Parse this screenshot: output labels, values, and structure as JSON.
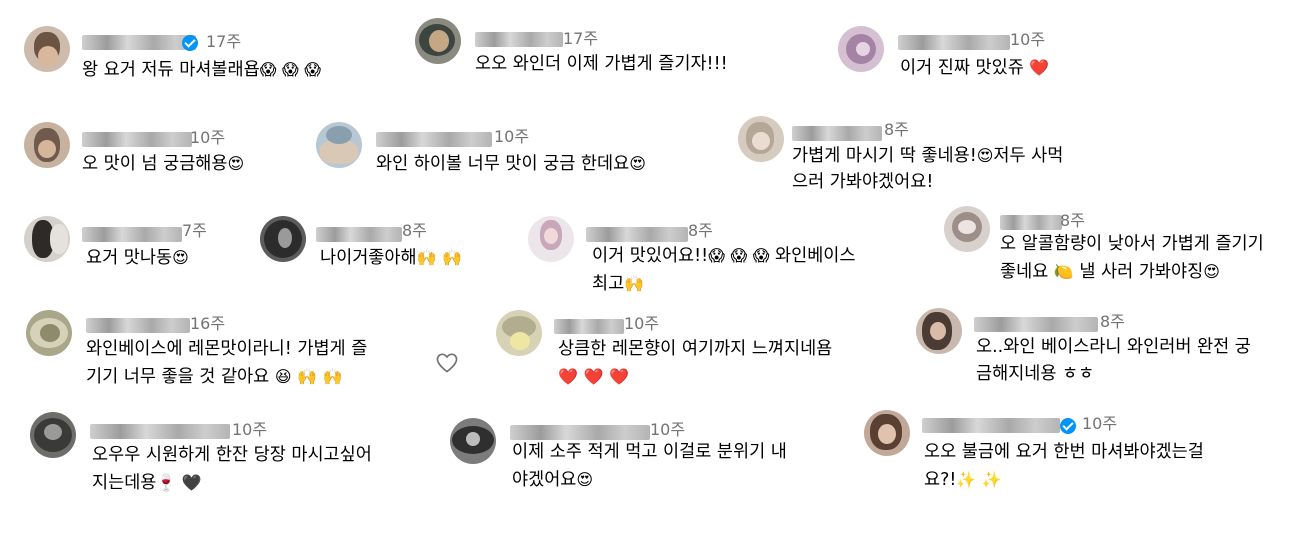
{
  "comments": [
    {
      "time": "17주",
      "text": [
        "왕 요거 저듀 마셔볼래욥"
      ],
      "emoji": [
        "😱",
        "😱",
        "😱"
      ],
      "verified": true
    },
    {
      "time": "17주",
      "text": [
        "오오 와인더 이제 가볍게 즐기자!!!"
      ],
      "emoji": [],
      "verified": false
    },
    {
      "time": "10주",
      "text": [
        "이거 진짜 맛있쥬"
      ],
      "emoji": [
        "❤️"
      ],
      "verified": false
    },
    {
      "time": "10주",
      "text": [
        "오 맛이 넘 궁금해용"
      ],
      "emoji": [
        "😍"
      ],
      "verified": false
    },
    {
      "time": "10주",
      "text": [
        "와인 하이볼 너무 맛이 궁금 한데요"
      ],
      "emoji": [
        "😍"
      ],
      "verified": false
    },
    {
      "time": "8주",
      "text": [
        "가볍게 마시기 딱 좋네용!",
        "으러 가봐야겠어요!"
      ],
      "emoji_inline": "😍",
      "after_emoji": "저두 사먹",
      "verified": false
    },
    {
      "time": "7주",
      "text": [
        "요거 맛나동"
      ],
      "emoji": [
        "😍"
      ],
      "verified": false
    },
    {
      "time": "8주",
      "text": [
        "나이거좋아해"
      ],
      "emoji": [
        "🙌",
        "🙌"
      ],
      "verified": false
    },
    {
      "time": "8주",
      "text": [
        "이거 맛있어요!!",
        "최고"
      ],
      "emoji": [
        "😱",
        "😱",
        "😱"
      ],
      "after_emoji": "와인베이스",
      "line2_emoji": [
        "🙌"
      ],
      "verified": false
    },
    {
      "time": "8주",
      "text": [
        "오 알콜함량이 낮아서 가볍게 즐기기",
        "좋네요"
      ],
      "line2_emoji": [
        "🍋"
      ],
      "line2_after": "낼 사러 가봐야징",
      "line2_end_emoji": [
        "😍"
      ],
      "verified": false
    },
    {
      "time": "16주",
      "text": [
        "와인베이스에 레몬맛이라니! 가볍게 즐",
        "기기 너무 좋을 것 같아요"
      ],
      "line2_emoji": [
        "😆",
        "🙌",
        "🙌"
      ],
      "verified": false
    },
    {
      "time": "10주",
      "text": [
        "상큼한 레몬향이 여기까지 느껴지네욤"
      ],
      "line2_emoji": [
        "❤️",
        "❤️",
        "❤️"
      ],
      "verified": false
    },
    {
      "time": "8주",
      "text": [
        "오..와인 베이스라니 와인러버 완전 궁",
        "금해지네용 ㅎㅎ"
      ],
      "verified": false
    },
    {
      "time": "10주",
      "text": [
        "오우우 시원하게 한잔 당장 마시고싶어",
        "지는데용"
      ],
      "line2_emoji": [
        "🍷",
        "🖤"
      ],
      "verified": false
    },
    {
      "time": "10주",
      "text": [
        "이제 소주 적게 먹고 이걸로 분위기 내",
        "야겠어요"
      ],
      "line2_emoji": [
        "😍"
      ],
      "verified": false
    },
    {
      "time": "10주",
      "text": [
        "오오 불금에 요거 한번 마셔봐야겠는걸",
        "요?!"
      ],
      "line2_emoji": [
        "✨",
        "✨"
      ],
      "verified": true
    }
  ],
  "icons": {
    "like": "heart-outline-icon",
    "verified": "verified-badge-icon"
  },
  "colors": {
    "text": "#000000",
    "muted": "#737373",
    "verified": "#0095f6"
  }
}
